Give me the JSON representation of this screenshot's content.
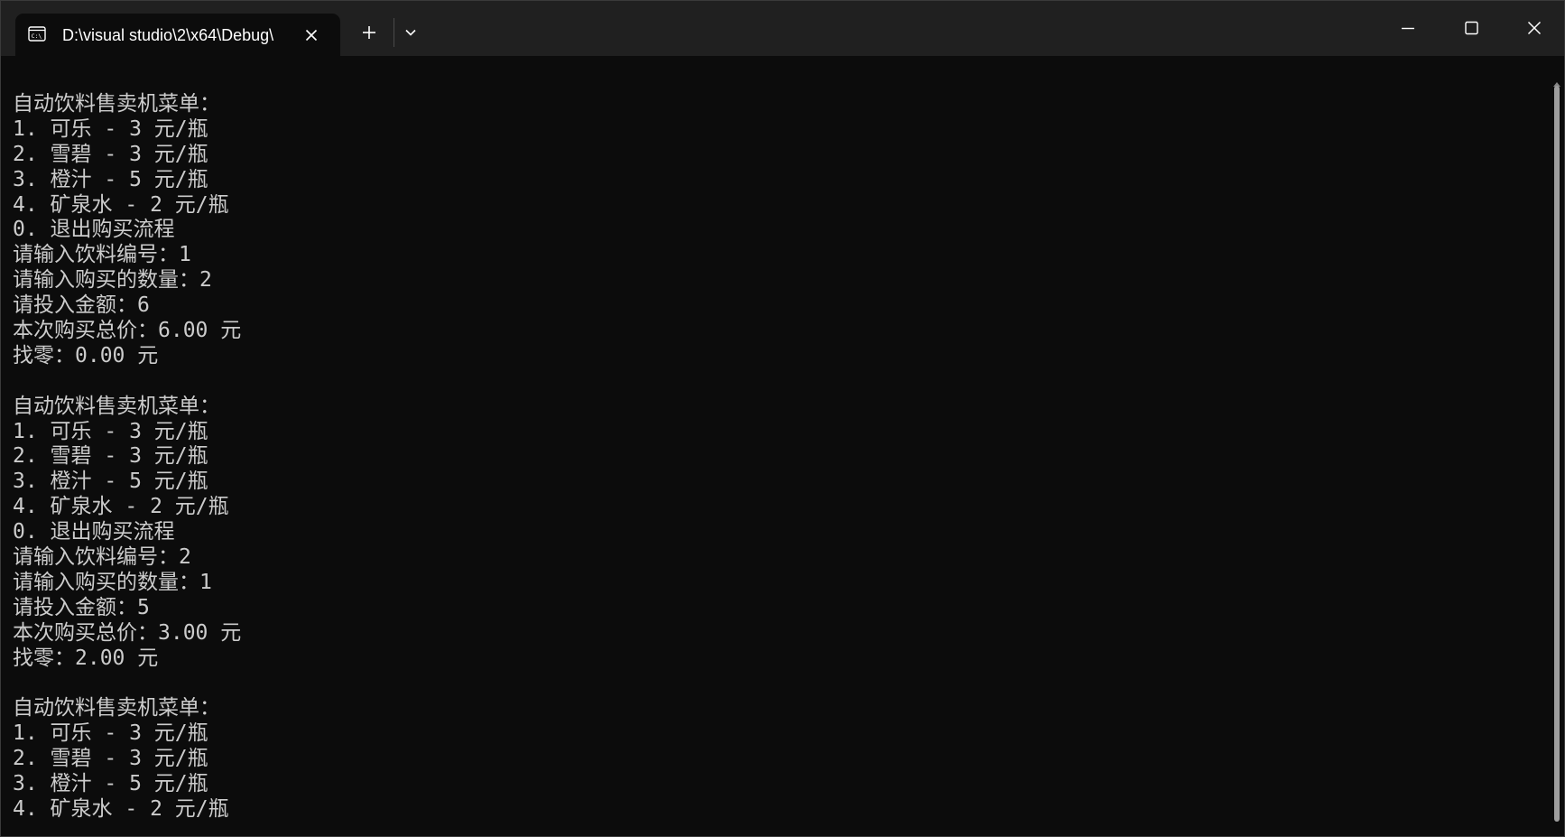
{
  "window": {
    "tab_title": "D:\\visual studio\\2\\x64\\Debug\\",
    "tab_icon": "console-icon",
    "icons": {
      "close_tab": "close-icon",
      "new_tab": "plus-icon",
      "dropdown": "chevron-down-icon",
      "minimize": "minimize-icon",
      "maximize": "maximize-icon",
      "close": "close-icon"
    }
  },
  "colors": {
    "titlebar": "#202020",
    "console_background": "#0c0c0c",
    "console_text": "#cccccc",
    "scrollbar_thumb": "#9e9e9e"
  },
  "console": {
    "lines": [
      "自动饮料售卖机菜单：",
      "1. 可乐 - 3 元/瓶",
      "2. 雪碧 - 3 元/瓶",
      "3. 橙汁 - 5 元/瓶",
      "4. 矿泉水 - 2 元/瓶",
      "0. 退出购买流程",
      "请输入饮料编号：1",
      "请输入购买的数量：2",
      "请投入金额：6",
      "本次购买总价：6.00 元",
      "找零：0.00 元",
      "",
      "自动饮料售卖机菜单：",
      "1. 可乐 - 3 元/瓶",
      "2. 雪碧 - 3 元/瓶",
      "3. 橙汁 - 5 元/瓶",
      "4. 矿泉水 - 2 元/瓶",
      "0. 退出购买流程",
      "请输入饮料编号：2",
      "请输入购买的数量：1",
      "请投入金额：5",
      "本次购买总价：3.00 元",
      "找零：2.00 元",
      "",
      "自动饮料售卖机菜单：",
      "1. 可乐 - 3 元/瓶",
      "2. 雪碧 - 3 元/瓶",
      "3. 橙汁 - 5 元/瓶",
      "4. 矿泉水 - 2 元/瓶"
    ]
  }
}
